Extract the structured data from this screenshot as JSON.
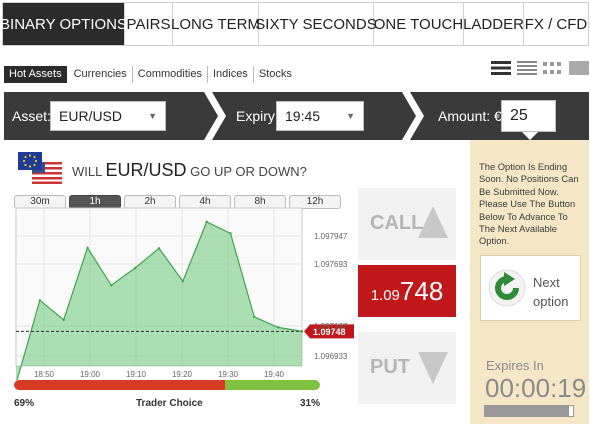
{
  "top_tabs": [
    "BINARY OPTIONS",
    "PAIRS",
    "LONG TERM",
    "SIXTY SECONDS",
    "ONE TOUCH",
    "LADDER",
    "FX / CFD"
  ],
  "sub_tabs": [
    "Hot Assets",
    "Currencies",
    "Commodities",
    "Indices",
    "Stocks"
  ],
  "view_icons": [
    "view-list-thick-icon",
    "view-list-icon",
    "view-grid-icon",
    "view-tile-icon"
  ],
  "asset_bar": {
    "asset_label": "Asset:",
    "asset_value": "EUR/USD",
    "expiry_label": "Expiry:",
    "expiry_value": "19:45",
    "amount_label": "Amount: €",
    "amount_value": "25"
  },
  "question": {
    "prefix": "WILL ",
    "asset": "EUR/USD",
    "suffix": " GO UP OR DOWN?"
  },
  "timeframes": [
    "30m",
    "1h",
    "2h",
    "4h",
    "8h",
    "12h"
  ],
  "active_timeframe": "1h",
  "chart_data": {
    "type": "area",
    "x": [
      "18:45",
      "18:50",
      "18:55",
      "19:00",
      "19:05",
      "19:10",
      "19:15",
      "19:20",
      "19:25",
      "19:30",
      "19:35",
      "19:40",
      "19:44"
    ],
    "series": [
      {
        "values": [
          1.09657,
          1.09802,
          1.09768,
          1.09893,
          1.09828,
          1.09858,
          1.09892,
          1.09835,
          1.09938,
          1.09918,
          1.09773,
          1.09755,
          1.09748
        ]
      }
    ],
    "xtick_labels": [
      "18:50",
      "19:00",
      "19:10",
      "19:20",
      "19:30",
      "19:40"
    ],
    "ytick_labels": [
      "1.097947",
      "1.097693",
      "1.097187",
      "1.096933"
    ],
    "current_label": "1.09748",
    "ylim": [
      1.09688,
      1.09962
    ],
    "grid": true,
    "color": "#6cc67a"
  },
  "trader_choice": {
    "label": "Trader Choice",
    "left_pct": "69%",
    "right_pct": "31%",
    "left_share": 0.69
  },
  "call": {
    "label": "CALL"
  },
  "put": {
    "label": "PUT"
  },
  "price": {
    "lo": "1.09",
    "hi": "748"
  },
  "info_message": "The Option Is Ending Soon. No Positions Can Be Submitted Now. Please Use The Button Below To Advance To The Next Available Option.",
  "next_option": {
    "line1": "Next",
    "line2": "option"
  },
  "expires": {
    "label": "Expires In",
    "time": "00:00:19",
    "progress": 0.95
  },
  "colors": {
    "dark": "#2b2b2b",
    "red": "#c0181a",
    "green": "#7fc241",
    "beige": "#f5e7c6"
  }
}
